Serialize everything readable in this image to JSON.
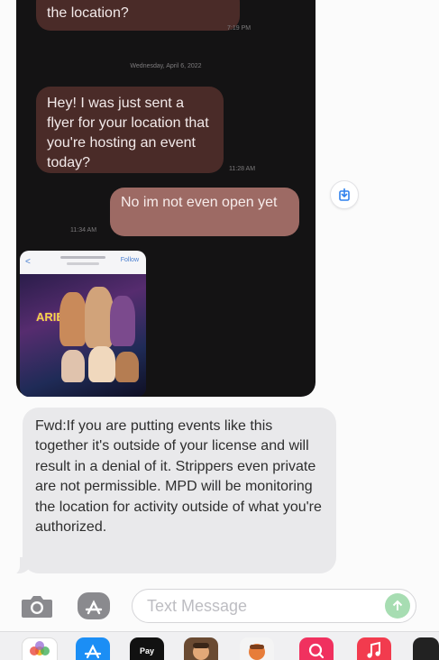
{
  "conversation": {
    "top_message_tail": "the location?",
    "top_message_time": "7:19 PM",
    "date_separator": "Wednesday, April 6, 2022",
    "incoming_message": "Hey! I was just sent a flyer for your location that you're hosting an event today?",
    "incoming_time": "11:28 AM",
    "outgoing_message": "No im not even open yet",
    "outgoing_time": "11:34 AM",
    "flyer_preview": {
      "back_label": "<",
      "follow_label": "Follow",
      "vertical_title": "ARIES"
    },
    "forwarded_message": "Fwd:If you are putting events like this together it's outside of your license and will result in a denial of it. Strippers even private are not permissible. MPD will be monitoring the location for activity outside of what you're authorized."
  },
  "composer": {
    "placeholder": "Text Message"
  },
  "app_strip": {
    "items": [
      {
        "name": "photos",
        "color": "#ffffff",
        "label": ""
      },
      {
        "name": "app-store",
        "color": "#1b8ef5",
        "label": ""
      },
      {
        "name": "apple-pay",
        "color": "#111111",
        "label": "Pay"
      },
      {
        "name": "memoji-1",
        "color": "#6a4a32",
        "label": ""
      },
      {
        "name": "memoji-2",
        "color": "#e77d3a",
        "label": ""
      },
      {
        "name": "search-gifs",
        "color": "#f0315f",
        "label": ""
      },
      {
        "name": "music",
        "color": "#f23b4e",
        "label": ""
      },
      {
        "name": "more",
        "color": "#222222",
        "label": ""
      }
    ]
  },
  "colors": {
    "dark_background": "#141314",
    "incoming_dark_bubble": "#4a2b28",
    "outgoing_dark_bubble": "#9d6a64",
    "received_bubble": "#e9e9eb",
    "send_button": "#a7ddb2",
    "share_icon": "#2f80ed"
  }
}
